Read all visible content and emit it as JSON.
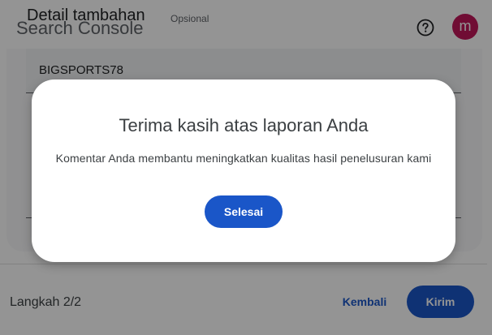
{
  "app": {
    "title": "Search Console",
    "avatar_letter": "m",
    "help_icon": "help-circle-icon",
    "avatar_color": "#c2185b"
  },
  "sheet": {
    "heading": "Detail tambahan",
    "optional_label": "Opsional",
    "site_value": "BIGSPORTS78"
  },
  "footer": {
    "step": "Langkah 2/2",
    "back_label": "Kembali",
    "submit_label": "Kirim"
  },
  "dialog": {
    "title": "Terima kasih atas laporan Anda",
    "body": "Komentar Anda membantu meningkatkan kualitas hasil penelusuran kami",
    "done_label": "Selesai"
  },
  "colors": {
    "accent": "#1a56c8",
    "scrim": "rgba(0,0,0,0.42)"
  }
}
